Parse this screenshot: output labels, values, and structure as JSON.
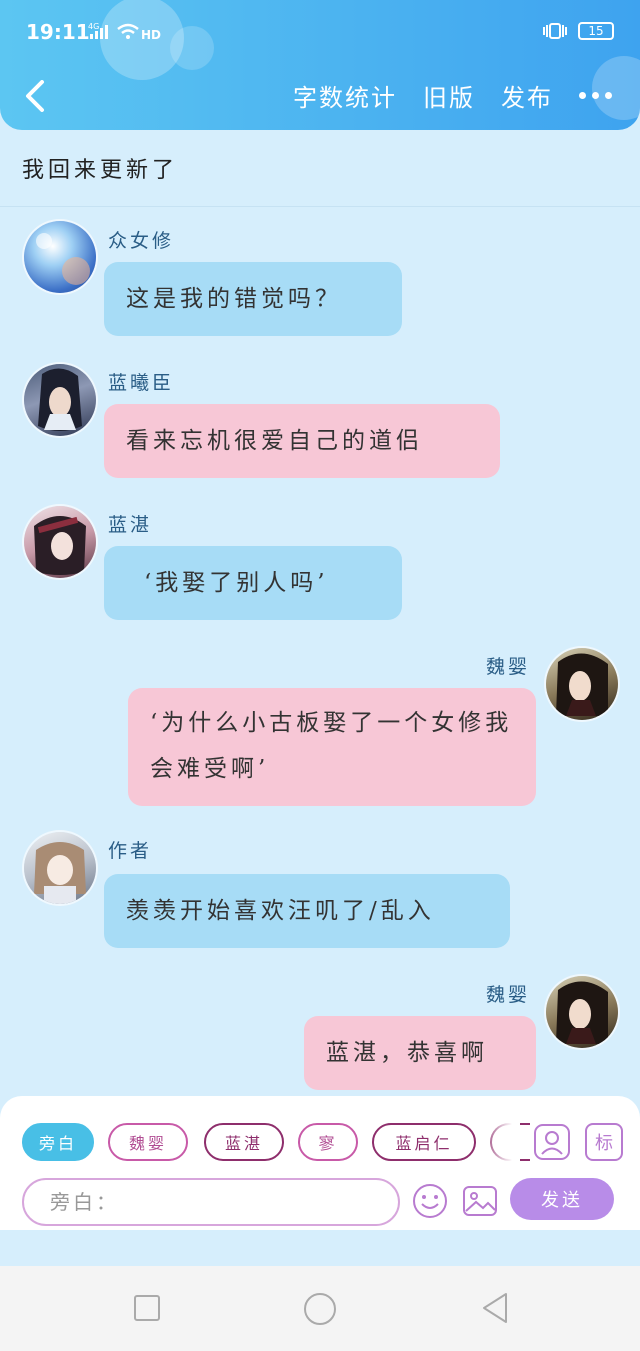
{
  "status_bar": {
    "time": "19:11",
    "network": "4G",
    "wifi": "HD",
    "battery": "15"
  },
  "header": {
    "actions": [
      {
        "label": "字数统计"
      },
      {
        "label": "旧版"
      },
      {
        "label": "发布"
      }
    ]
  },
  "chapter": {
    "title": "我回来更新了"
  },
  "messages": [
    {
      "sender": "众女修",
      "text": "这是我的错觉吗？",
      "side": "left",
      "color": "blue"
    },
    {
      "sender": "蓝曦臣",
      "text": "看来忘机很爱自己的道侣",
      "side": "left",
      "color": "pink"
    },
    {
      "sender": "蓝湛",
      "text": "‘我娶了别人吗’",
      "side": "left",
      "color": "blue"
    },
    {
      "sender": "魏婴",
      "text": "‘为什么小古板娶了一个女修我会难受啊’",
      "side": "right",
      "color": "pink"
    },
    {
      "sender": "作者",
      "text": "羡羡开始喜欢汪叽了/乱入",
      "side": "left",
      "color": "blue"
    },
    {
      "sender": "魏婴",
      "text": "蓝湛，恭喜啊",
      "side": "right",
      "color": "pink"
    }
  ],
  "composer": {
    "roles": [
      "旁白",
      "魏婴",
      "蓝湛",
      "寥",
      "蓝启仁"
    ],
    "active_role": "旁白",
    "mark_label": "标",
    "input_placeholder": "旁白：",
    "send_label": "发送"
  },
  "colors": {
    "header": "#3ea3ef",
    "background": "#d6eefc",
    "bubble_blue": "#a7dcf6",
    "bubble_pink": "#f7c7d6",
    "send": "#b88ce8"
  }
}
